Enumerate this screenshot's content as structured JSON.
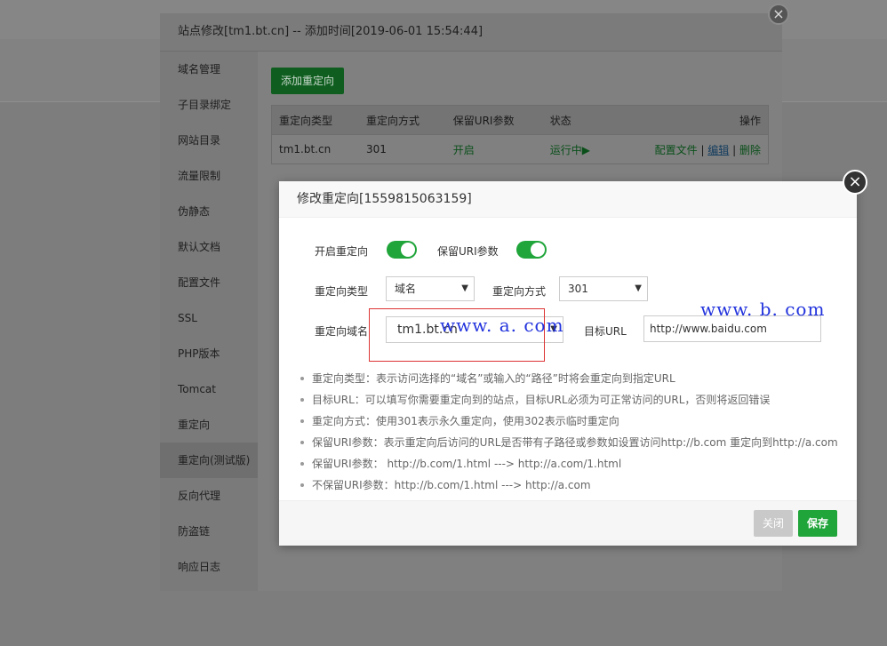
{
  "outer_dialog": {
    "title": "站点修改[tm1.bt.cn] -- 添加时间[2019-06-01 15:54:44]",
    "close_symbol": "×",
    "sidebar": [
      "域名管理",
      "子目录绑定",
      "网站目录",
      "流量限制",
      "伪静态",
      "默认文档",
      "配置文件",
      "SSL",
      "PHP版本",
      "Tomcat",
      "重定向",
      "重定向(测试版)",
      "反向代理",
      "防盗链",
      "响应日志"
    ],
    "active_item": "重定向(测试版)",
    "add_button": "添加重定向",
    "table": {
      "headers": [
        "重定向类型",
        "重定向方式",
        "保留URI参数",
        "状态",
        "操作"
      ],
      "rows": [
        {
          "domain": "tm1.bt.cn",
          "method": "301",
          "keep_uri": "开启",
          "status": "运行中▶",
          "ops": {
            "config": "配置文件",
            "sep1": " | ",
            "edit": "编辑",
            "sep2": " | ",
            "delete": "删除"
          }
        }
      ]
    }
  },
  "inner_dialog": {
    "title": "修改重定向[1559815063159]",
    "close_symbol": "×",
    "form": {
      "enable_label": "开启重定向",
      "enable_on": true,
      "keep_uri_label": "保留URI参数",
      "keep_uri_on": true,
      "type_label": "重定向类型",
      "type_value": "域名",
      "method_label": "重定向方式",
      "method_value": "301",
      "domain_label": "重定向域名",
      "domain_value": "tm1.bt.cn",
      "target_label": "目标URL",
      "target_value": "http://www.baidu.com"
    },
    "notes": [
      "重定向类型：表示访问选择的“域名”或输入的“路径”时将会重定向到指定URL",
      "目标URL：可以填写你需要重定向到的站点，目标URL必须为可正常访问的URL，否则将返回错误",
      "重定向方式：使用301表示永久重定向，使用302表示临时重定向",
      "保留URI参数：表示重定向后访问的URL是否带有子路径或参数如设置访问http://b.com 重定向到http://a.com",
      "保留URI参数：  http://b.com/1.html ---> http://a.com/1.html",
      "不保留URI参数：http://b.com/1.html ---> http://a.com"
    ],
    "close_button": "关闭",
    "save_button": "保存"
  },
  "annotations": {
    "watermark_a": "www. a. com",
    "watermark_b": "www. b. com"
  },
  "colors": {
    "accent_green": "#20a53a",
    "annotation_blue": "#2233dd",
    "annotation_red": "#dd3333"
  }
}
